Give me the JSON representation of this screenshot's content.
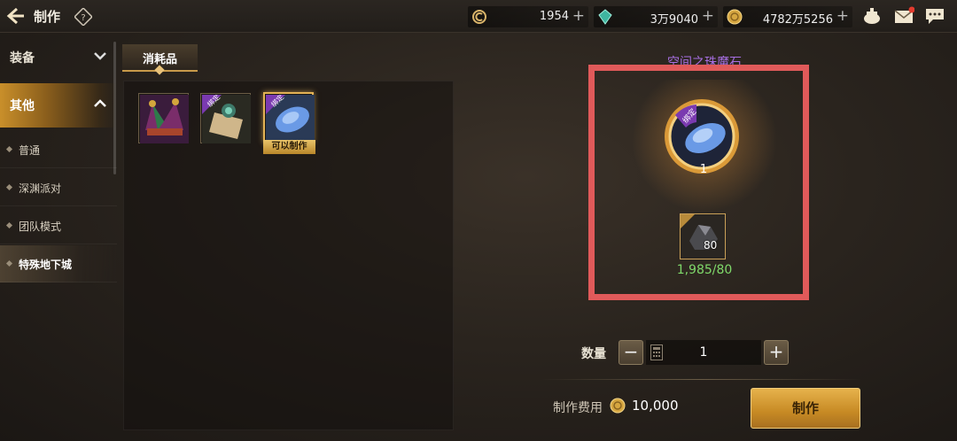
{
  "header": {
    "title": "制作",
    "currencies": [
      {
        "name": "c-coin",
        "value": "1954"
      },
      {
        "name": "gem",
        "value": "3万9040"
      },
      {
        "name": "gold",
        "value": "4782万5256"
      }
    ]
  },
  "sidebar": {
    "categories": [
      {
        "label": "装备",
        "expanded": false
      },
      {
        "label": "其他",
        "expanded": true
      }
    ],
    "subitems": [
      {
        "label": "普通"
      },
      {
        "label": "深渊派对"
      },
      {
        "label": "团队模式"
      },
      {
        "label": "特殊地下城",
        "selected": true
      }
    ]
  },
  "panel": {
    "tab_label": "消耗品",
    "items": [
      {
        "icon": "jester-hat-icon",
        "bound": false,
        "craftable": false
      },
      {
        "icon": "scroll-icon",
        "bound": true,
        "bound_label": "绑定",
        "craftable": false
      },
      {
        "icon": "blue-stone-icon",
        "bound": true,
        "bound_label": "绑定",
        "craftable": true,
        "craftable_label": "可以制作",
        "selected": true
      }
    ]
  },
  "detail": {
    "item_name": "空间之珠魔石",
    "output_count": "1",
    "bound_label": "绑定",
    "material": {
      "icon": "dark-ore-icon",
      "required": "80",
      "progress": "1,985/80"
    }
  },
  "craft": {
    "quantity_label": "数量",
    "minus": "−",
    "plus": "+",
    "quantity": "1",
    "cost_label": "制作费用",
    "cost": "10,000",
    "button_label": "制作"
  },
  "colors": {
    "accent_gold": "#e3b356",
    "highlight_red": "#e05a5a",
    "progress_green": "#7fd96a",
    "item_name_purple": "#a66ee0"
  }
}
